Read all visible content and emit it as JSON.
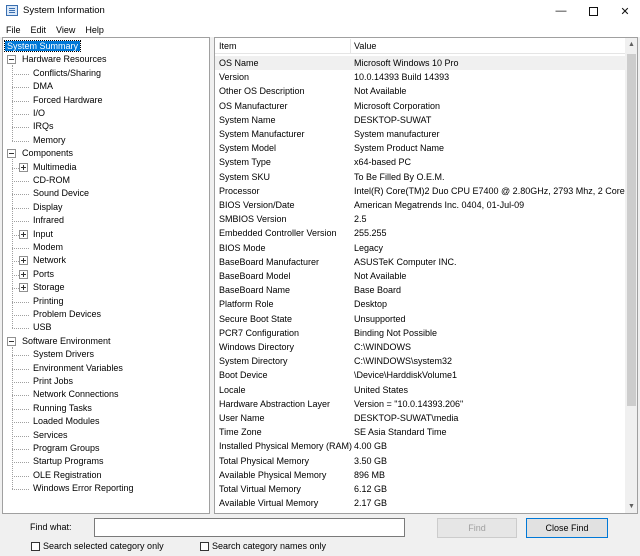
{
  "window": {
    "title": "System Information"
  },
  "menu": [
    "File",
    "Edit",
    "View",
    "Help"
  ],
  "tree": [
    {
      "label": "System Summary",
      "level": 0,
      "selected": true
    },
    {
      "label": "Hardware Resources",
      "level": 0,
      "expander": "minus"
    },
    {
      "label": "Conflicts/Sharing",
      "level": 1
    },
    {
      "label": "DMA",
      "level": 1
    },
    {
      "label": "Forced Hardware",
      "level": 1
    },
    {
      "label": "I/O",
      "level": 1
    },
    {
      "label": "IRQs",
      "level": 1
    },
    {
      "label": "Memory",
      "level": 1
    },
    {
      "label": "Components",
      "level": 0,
      "expander": "minus"
    },
    {
      "label": "Multimedia",
      "level": 1,
      "expander": "plus"
    },
    {
      "label": "CD-ROM",
      "level": 1
    },
    {
      "label": "Sound Device",
      "level": 1
    },
    {
      "label": "Display",
      "level": 1
    },
    {
      "label": "Infrared",
      "level": 1
    },
    {
      "label": "Input",
      "level": 1,
      "expander": "plus"
    },
    {
      "label": "Modem",
      "level": 1
    },
    {
      "label": "Network",
      "level": 1,
      "expander": "plus"
    },
    {
      "label": "Ports",
      "level": 1,
      "expander": "plus"
    },
    {
      "label": "Storage",
      "level": 1,
      "expander": "plus"
    },
    {
      "label": "Printing",
      "level": 1
    },
    {
      "label": "Problem Devices",
      "level": 1
    },
    {
      "label": "USB",
      "level": 1
    },
    {
      "label": "Software Environment",
      "level": 0,
      "expander": "minus"
    },
    {
      "label": "System Drivers",
      "level": 1
    },
    {
      "label": "Environment Variables",
      "level": 1
    },
    {
      "label": "Print Jobs",
      "level": 1
    },
    {
      "label": "Network Connections",
      "level": 1
    },
    {
      "label": "Running Tasks",
      "level": 1
    },
    {
      "label": "Loaded Modules",
      "level": 1
    },
    {
      "label": "Services",
      "level": 1
    },
    {
      "label": "Program Groups",
      "level": 1
    },
    {
      "label": "Startup Programs",
      "level": 1
    },
    {
      "label": "OLE Registration",
      "level": 1
    },
    {
      "label": "Windows Error Reporting",
      "level": 1
    }
  ],
  "table": {
    "columns": [
      "Item",
      "Value"
    ],
    "rows": [
      {
        "item": "OS Name",
        "value": "Microsoft Windows 10 Pro",
        "highlight": true
      },
      {
        "item": "Version",
        "value": "10.0.14393 Build 14393"
      },
      {
        "item": "Other OS Description",
        "value": "Not Available"
      },
      {
        "item": "OS Manufacturer",
        "value": "Microsoft Corporation"
      },
      {
        "item": "System Name",
        "value": "DESKTOP-SUWAT"
      },
      {
        "item": "System Manufacturer",
        "value": "System manufacturer"
      },
      {
        "item": "System Model",
        "value": "System Product Name"
      },
      {
        "item": "System Type",
        "value": "x64-based PC"
      },
      {
        "item": "System SKU",
        "value": "To Be Filled By O.E.M."
      },
      {
        "item": "Processor",
        "value": "Intel(R) Core(TM)2 Duo CPU     E7400  @ 2.80GHz, 2793 Mhz, 2 Core"
      },
      {
        "item": "BIOS Version/Date",
        "value": "American Megatrends Inc. 0404, 01-Jul-09"
      },
      {
        "item": "SMBIOS Version",
        "value": "2.5"
      },
      {
        "item": "Embedded Controller Version",
        "value": "255.255"
      },
      {
        "item": "BIOS Mode",
        "value": "Legacy"
      },
      {
        "item": "BaseBoard Manufacturer",
        "value": "ASUSTeK Computer INC."
      },
      {
        "item": "BaseBoard Model",
        "value": "Not Available"
      },
      {
        "item": "BaseBoard Name",
        "value": "Base Board"
      },
      {
        "item": "Platform Role",
        "value": "Desktop"
      },
      {
        "item": "Secure Boot State",
        "value": "Unsupported"
      },
      {
        "item": "PCR7 Configuration",
        "value": "Binding Not Possible"
      },
      {
        "item": "Windows Directory",
        "value": "C:\\WINDOWS"
      },
      {
        "item": "System Directory",
        "value": "C:\\WINDOWS\\system32"
      },
      {
        "item": "Boot Device",
        "value": "\\Device\\HarddiskVolume1"
      },
      {
        "item": "Locale",
        "value": "United States"
      },
      {
        "item": "Hardware Abstraction Layer",
        "value": "Version = \"10.0.14393.206\""
      },
      {
        "item": "User Name",
        "value": "DESKTOP-SUWAT\\media"
      },
      {
        "item": "Time Zone",
        "value": "SE Asia Standard Time"
      },
      {
        "item": "Installed Physical Memory (RAM)",
        "value": "4.00 GB"
      },
      {
        "item": "Total Physical Memory",
        "value": "3.50 GB"
      },
      {
        "item": "Available Physical Memory",
        "value": "896 MB"
      },
      {
        "item": "Total Virtual Memory",
        "value": "6.12 GB"
      },
      {
        "item": "Available Virtual Memory",
        "value": "2.17 GB"
      }
    ]
  },
  "find": {
    "label": "Find what:",
    "value": "",
    "find_button": "Find",
    "close_find_button": "Close Find",
    "search_selected": "Search selected category only",
    "search_names": "Search category names only"
  },
  "colors": {
    "selection": "#0078d7",
    "highlight_row": "#f0f0f0"
  }
}
